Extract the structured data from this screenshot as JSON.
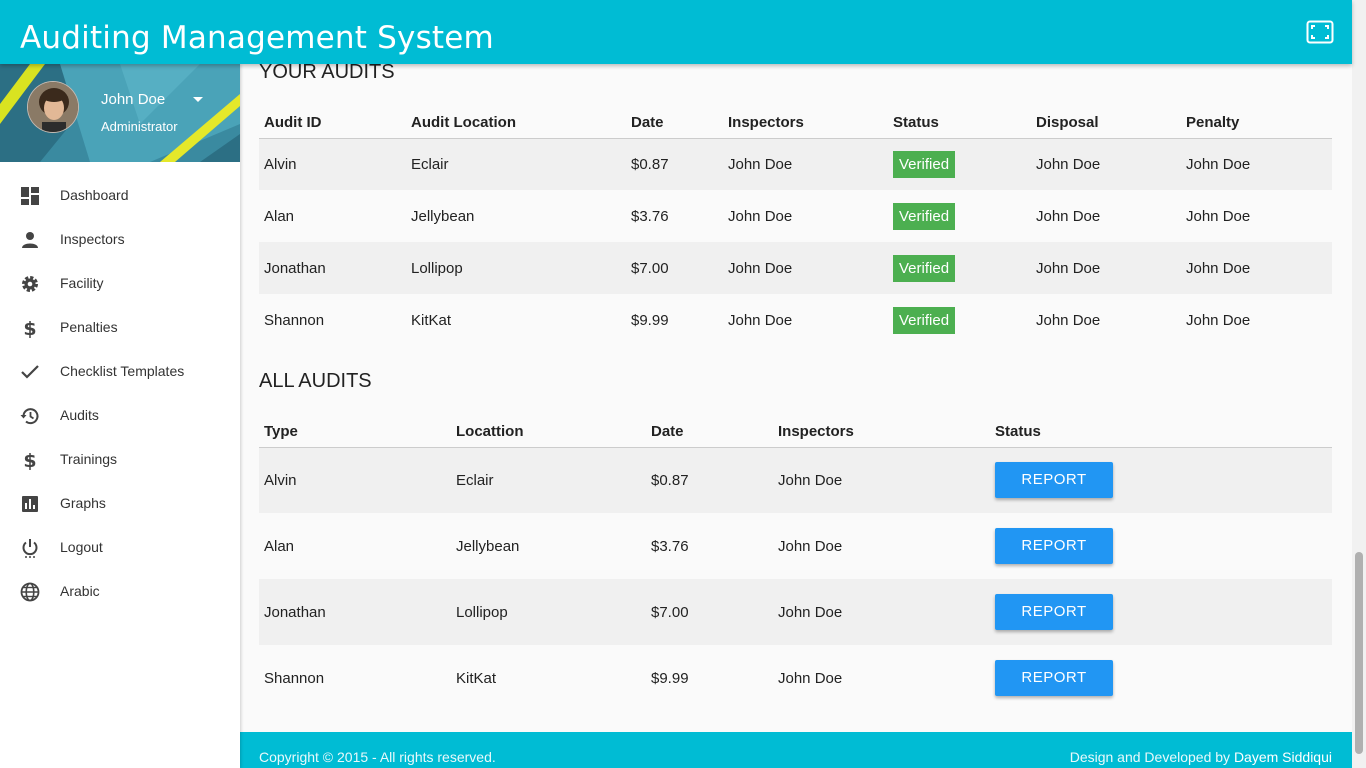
{
  "header": {
    "title": "Auditing Management System",
    "fullscreen_icon": "fullscreen-icon"
  },
  "colors": {
    "primary": "#00bcd4",
    "verified": "#4caf50",
    "button": "#2196f3"
  },
  "profile": {
    "name": "John Doe",
    "role": "Administrator"
  },
  "sidebar": {
    "items": [
      {
        "label": "Dashboard",
        "icon": "dashboard-icon"
      },
      {
        "label": "Inspectors",
        "icon": "person-icon"
      },
      {
        "label": "Facility",
        "icon": "gear-icon"
      },
      {
        "label": "Penalties",
        "icon": "dollar-icon"
      },
      {
        "label": "Checklist Templates",
        "icon": "check-icon"
      },
      {
        "label": "Audits",
        "icon": "history-icon"
      },
      {
        "label": "Trainings",
        "icon": "dollar-icon"
      },
      {
        "label": "Graphs",
        "icon": "chart-icon"
      },
      {
        "label": "Logout",
        "icon": "power-icon"
      },
      {
        "label": "Arabic",
        "icon": "globe-icon"
      }
    ]
  },
  "your_audits": {
    "title": "YOUR AUDITS",
    "columns": [
      "Audit ID",
      "Audit Location",
      "Date",
      "Inspectors",
      "Status",
      "Disposal",
      "Penalty"
    ],
    "rows": [
      [
        "Alvin",
        "Eclair",
        "$0.87",
        "John Doe",
        "Verified",
        "John Doe",
        "John Doe"
      ],
      [
        "Alan",
        "Jellybean",
        "$3.76",
        "John Doe",
        "Verified",
        "John Doe",
        "John Doe"
      ],
      [
        "Jonathan",
        "Lollipop",
        "$7.00",
        "John Doe",
        "Verified",
        "John Doe",
        "John Doe"
      ],
      [
        "Shannon",
        "KitKat",
        "$9.99",
        "John Doe",
        "Verified",
        "John Doe",
        "John Doe"
      ]
    ]
  },
  "all_audits": {
    "title": "ALL AUDITS",
    "columns": [
      "Type",
      "Locattion",
      "Date",
      "Inspectors",
      "Status"
    ],
    "rows": [
      [
        "Alvin",
        "Eclair",
        "$0.87",
        "John Doe",
        "REPORT"
      ],
      [
        "Alan",
        "Jellybean",
        "$3.76",
        "John Doe",
        "REPORT"
      ],
      [
        "Jonathan",
        "Lollipop",
        "$7.00",
        "John Doe",
        "REPORT"
      ],
      [
        "Shannon",
        "KitKat",
        "$9.99",
        "John Doe",
        "REPORT"
      ]
    ]
  },
  "footer": {
    "copyright": "Copyright © 2015 - All rights reserved.",
    "credit_prefix": "Design and Developed by ",
    "credit_name": "Dayem Siddiqui"
  }
}
